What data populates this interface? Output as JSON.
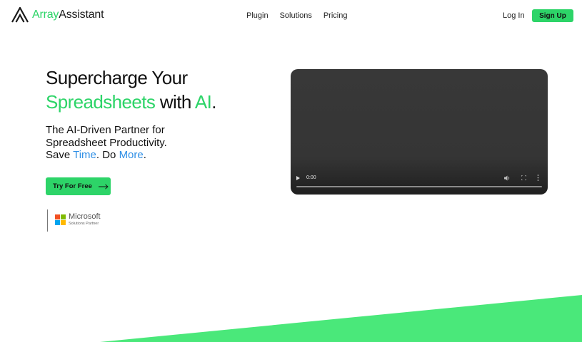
{
  "brand": {
    "name_part1": "Array",
    "name_part2": "Assistant",
    "icon": "array-assistant-logo-icon"
  },
  "nav": {
    "items": [
      {
        "label": "Plugin"
      },
      {
        "label": "Solutions"
      },
      {
        "label": "Pricing"
      }
    ],
    "login_label": "Log In",
    "signup_label": "Sign Up"
  },
  "hero": {
    "headline": {
      "line1": "Supercharge Your",
      "highlight1": "Spreadsheets",
      "mid": " with ",
      "highlight2": "AI",
      "end": "."
    },
    "subtext": {
      "line1": "The AI-Driven Partner for",
      "line2": "Spreadsheet Productivity.",
      "line3_a": "Save ",
      "line3_b": "Time",
      "line3_c": ". Do ",
      "line3_d": "More",
      "line3_e": "."
    },
    "cta_label": "Try For Free",
    "cta_icon": "arrow-right-icon"
  },
  "partner": {
    "name": "Microsoft",
    "subtitle": "Solutions Partner",
    "icon": "microsoft-logo-icon"
  },
  "video": {
    "time": "0:00",
    "progress": 0,
    "controls": [
      "play-icon",
      "volume-icon",
      "fullscreen-icon",
      "more-options-icon"
    ]
  },
  "colors": {
    "accent_green": "#2dd468",
    "accent_blue": "#2f8fe6",
    "video_bg": "#353535",
    "text": "#111111"
  }
}
